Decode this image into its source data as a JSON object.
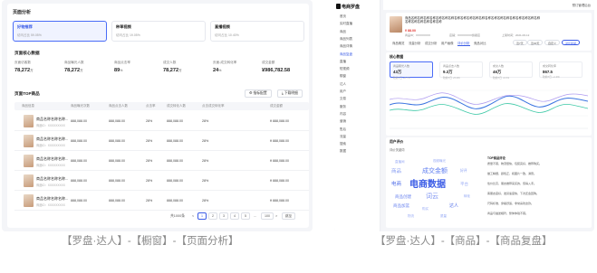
{
  "left": {
    "section_title": "页面分析",
    "tabs": [
      {
        "title": "好物推荐",
        "sub": "访问占比 59.05%"
      },
      {
        "title": "种草视频",
        "sub": "访问占比 19.05%"
      },
      {
        "title": "直播视频",
        "sub": "访问占比 10.40%"
      }
    ],
    "core_title": "页面核心数据",
    "metrics": [
      {
        "label": "页面访客数",
        "value": "78,272",
        "unit": "万"
      },
      {
        "label": "商品曝光人数",
        "value": "78,272",
        "unit": "万"
      },
      {
        "label": "商品点击率",
        "value": "89",
        "unit": "%"
      },
      {
        "label": "成交人数",
        "value": "78,272",
        "unit": "万"
      },
      {
        "label": "页面-成交转化率",
        "value": "24",
        "unit": "%"
      },
      {
        "label": "成交金额",
        "value": "¥986,782.58",
        "unit": ""
      }
    ],
    "top_title": "页面TOP商品",
    "buttons": {
      "metric": "指标配置",
      "download": "下载明细"
    },
    "columns": [
      "商品信息",
      "商品曝光次数",
      "商品点击人数",
      "点击率",
      "成交转化人数",
      "点击成交转化率",
      "成交金额"
    ],
    "rows": [
      {
        "name": "商品名称名称名称...",
        "sub": "商品ID：XXXXXXXXX",
        "c1": "888,088.00",
        "c2": "888,088.00",
        "c3": "28%",
        "c4": "888,088.00",
        "c5": "28%",
        "c6": "¥ 888,088.00"
      },
      {
        "name": "商品名称名称名称...",
        "sub": "商品ID：XXXXXXXXX",
        "c1": "888,088.00",
        "c2": "888,088.00",
        "c3": "28%",
        "c4": "888,088.00",
        "c5": "28%",
        "c6": "¥ 888,088.00"
      },
      {
        "name": "商品名称名称名称...",
        "sub": "商品ID：XXXXXXXXX",
        "c1": "888,088.00",
        "c2": "888,088.00",
        "c3": "28%",
        "c4": "888,088.00",
        "c5": "28%",
        "c6": "¥ 888,088.00"
      },
      {
        "name": "商品名称名称名称...",
        "sub": "商品ID：XXXXXXXXX",
        "c1": "888,088.00",
        "c2": "888,088.00",
        "c3": "28%",
        "c4": "888,088.00",
        "c5": "28%",
        "c6": "¥ 888,088.00"
      },
      {
        "name": "商品名称名称名称...",
        "sub": "商品ID：XXXXXXXXX",
        "c1": "888,088.00",
        "c2": "888,088.00",
        "c3": "28%",
        "c4": "888,088.00",
        "c5": "28%",
        "c6": "¥ 888,088.00"
      }
    ],
    "pagination": {
      "total": "共1000条",
      "prev": "<",
      "pages": [
        "1",
        "2",
        "3",
        "4",
        "5",
        "...",
        "100"
      ],
      "next": ">",
      "size": "10条/页",
      "jump": "跳至"
    },
    "caption": "【罗盘·达人】-【橱窗】-【页面分析】"
  },
  "right": {
    "logo": "电商罗盘",
    "top_badge": "预订管理后台",
    "sidebar": [
      "首页",
      "实时直播",
      "商品",
      "商品列表",
      "商品详情",
      "商品复盘",
      "直播",
      "短视频",
      "橱窗",
      "达人",
      "用户",
      "交易",
      "服务",
      "内容",
      "营销",
      "售后",
      "流量",
      "搜索",
      "数据"
    ],
    "sidebar_active": "商品复盘",
    "product": {
      "title": "商品名称名称名称名称名称名称名称名称名称名称名称名称名称名称名称名称名称名称名称名称名称名称名称名称名称名称名称",
      "price": "¥ 88.00",
      "meta1": "商品ID：XXXXXXXX",
      "meta2": "店铺：XXXXXXXX旗舰店",
      "meta3": "上架时间：2021-06-12"
    },
    "tabs": [
      "商品概览",
      "流量分析",
      "成交分析",
      "用户画像",
      "评价分析",
      "竞品对比"
    ],
    "tab_active": "评价分析",
    "pills": [
      "近7天",
      "近30天",
      "自定义",
      "对比时间"
    ],
    "panel_title": "核心数据",
    "kpis": [
      {
        "label": "商品曝光人数",
        "value": "43万",
        "delta": "较前7日 +8.7%"
      },
      {
        "label": "商品点击人数",
        "value": "9.3万",
        "delta": "较前7日 +5.2%"
      },
      {
        "label": "成交人数",
        "value": "46万",
        "delta": "较前7日 -2.1%"
      },
      {
        "label": "成交转化率",
        "value": "867.5",
        "delta": "较前7日 +1.3%"
      }
    ],
    "panel2_title": "用户评价",
    "panel2_sub": "评价关键词",
    "words": [
      "电商数据",
      "成交金额",
      "商品",
      "电商",
      "词云",
      "商品创建",
      "视频曝光",
      "平台",
      "商品加篮",
      "达人",
      "直播间",
      "转化",
      "购买",
      "好评",
      "物流",
      "质量"
    ],
    "list_header": "TOP商品评论",
    "list_rows": [
      "质量不错，物流很快，包装完好，推荐购买。",
      "做工精细，颜色正，和图片一致，满意。",
      "性价比高，朋友推荐来买的，值得入手。",
      "客服态度好，发货速度快，下次还会回购。",
      "尺码标准，穿着舒适，非常喜欢这款。",
      "商品与描述相符，整体体验不错。"
    ],
    "caption": "【罗盘·达人】-【商品】-【商品复盘】"
  },
  "colors": {
    "accent": "#3b5ce6",
    "line_blue": "#3a74e0",
    "line_green": "#3ec9a7",
    "line_purple": "#8a6ee8"
  }
}
